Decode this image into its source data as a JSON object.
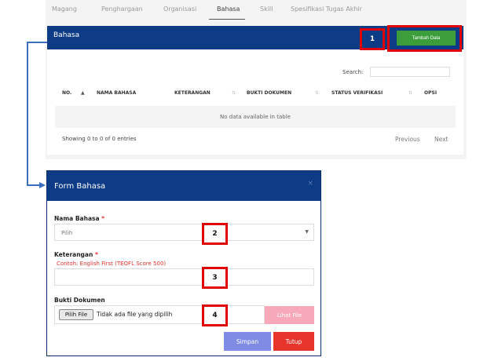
{
  "tabs": [
    {
      "label": "Magang"
    },
    {
      "label": "Penghargaan"
    },
    {
      "label": "Organisasi"
    },
    {
      "label": "Bahasa"
    },
    {
      "label": "Skill"
    },
    {
      "label": "Spesifikasi Tugas Akhir"
    }
  ],
  "active_tab": "Bahasa",
  "card": {
    "title": "Bahasa",
    "add_button": "Tambah Data",
    "search_label": "Search:",
    "search_value": "",
    "columns": [
      {
        "label": "NO."
      },
      {
        "label": "NAMA BAHASA"
      },
      {
        "label": "KETERANGAN"
      },
      {
        "label": "BUKTI DOKUMEN"
      },
      {
        "label": "STATUS VERIFIKASI"
      },
      {
        "label": "OPSI"
      }
    ],
    "empty_text": "No data available in table",
    "info": "Showing 0 to 0 of 0 entries",
    "previous": "Previous",
    "next": "Next"
  },
  "annotations": {
    "n1": "1",
    "n2": "2",
    "n3": "3",
    "n4": "4"
  },
  "modal": {
    "title": "Form Bahasa",
    "close_icon": "×",
    "nama_label": "Nama Bahasa",
    "required_mark": "*",
    "nama_value": "Pilih",
    "ket_label": "Keterangan",
    "ket_hint": "Contoh: English First (TEOFL Score 500)",
    "ket_value": "",
    "bukti_label": "Bukti Dokumen",
    "file_button": "Pilih File",
    "file_status": "Tidak ada file yang dipilih",
    "lihat_button": "Lihat File",
    "simpan_button": "Simpan",
    "tutup_button": "Tutup"
  },
  "colors": {
    "header_blue": "#0d3b85",
    "add_green": "#3b9e3b",
    "annotation_red": "#e00000",
    "simpan": "#7f8ce6",
    "tutup": "#e8352c",
    "lihat": "#f7a9b9"
  }
}
